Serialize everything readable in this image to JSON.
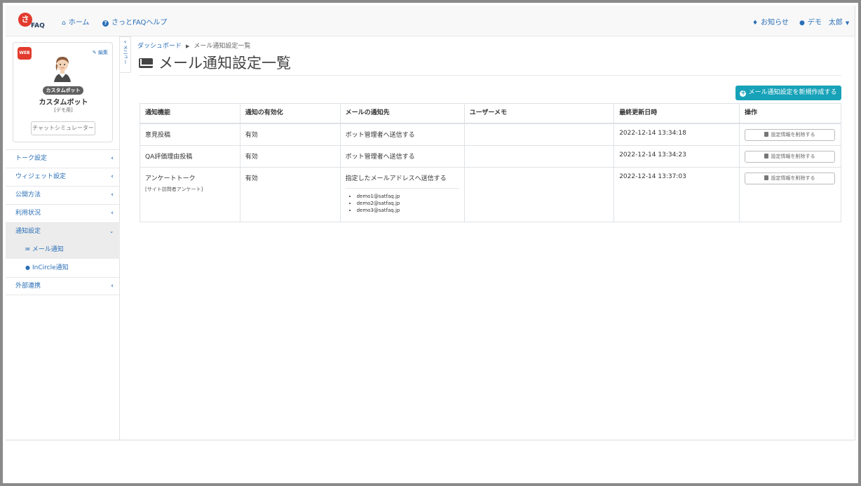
{
  "header": {
    "logo_text": "FAQ",
    "logo_mark": "さ",
    "home_label": "ホーム",
    "help_label": "さっとFAQヘルプ",
    "notice_label": "お知らせ",
    "user_label": "デモ　太郎"
  },
  "profile": {
    "web_badge": "WEB",
    "edit_label": "編集",
    "bot_tag": "カスタムボット",
    "bot_name": "カスタムボット",
    "bot_sub": "[デモ用]",
    "simulator_label": "チャットシミュレーター"
  },
  "menu_tab": {
    "arrow": "‹",
    "label": "メニュー"
  },
  "sidebar": {
    "items": [
      {
        "label": "トーク設定"
      },
      {
        "label": "ウィジェット設定"
      },
      {
        "label": "公開方法"
      },
      {
        "label": "利用状況"
      },
      {
        "label": "通知設定"
      },
      {
        "label": "外部連携"
      }
    ],
    "sub_items": [
      {
        "label": "メール通知"
      },
      {
        "label": "InCircle通知"
      }
    ]
  },
  "breadcrumb": {
    "dashboard": "ダッシュボード",
    "current": "メール通知設定一覧"
  },
  "page_title": "メール通知設定一覧",
  "add_button_label": "メール通知設定を新規作成する",
  "table": {
    "headers": [
      "通知機能",
      "通知の有効化",
      "メールの通知先",
      "ユーザーメモ",
      "最終更新日時",
      "操作"
    ],
    "rows": [
      {
        "feature": "意見投稿",
        "note": "",
        "enabled": "有効",
        "destination": "ボット管理者へ送信する",
        "memo": "",
        "updated": "2022-12-14 13:34:18",
        "action": "設定情報を削除する"
      },
      {
        "feature": "QA評価理由投稿",
        "note": "",
        "enabled": "有効",
        "destination": "ボット管理者へ送信する",
        "memo": "",
        "updated": "2022-12-14 13:34:23",
        "action": "設定情報を削除する"
      },
      {
        "feature": "アンケートトーク",
        "note": "[サイト訪問者アンケート]",
        "enabled": "有効",
        "destination": "指定したメールアドレスへ送信する",
        "memo": "",
        "updated": "2022-12-14 13:37:03",
        "action": "設定情報を削除する",
        "emails": [
          "demo1@satfaq.jp",
          "demo2@satfaq.jp",
          "demo3@satfaq.jp"
        ]
      }
    ]
  }
}
